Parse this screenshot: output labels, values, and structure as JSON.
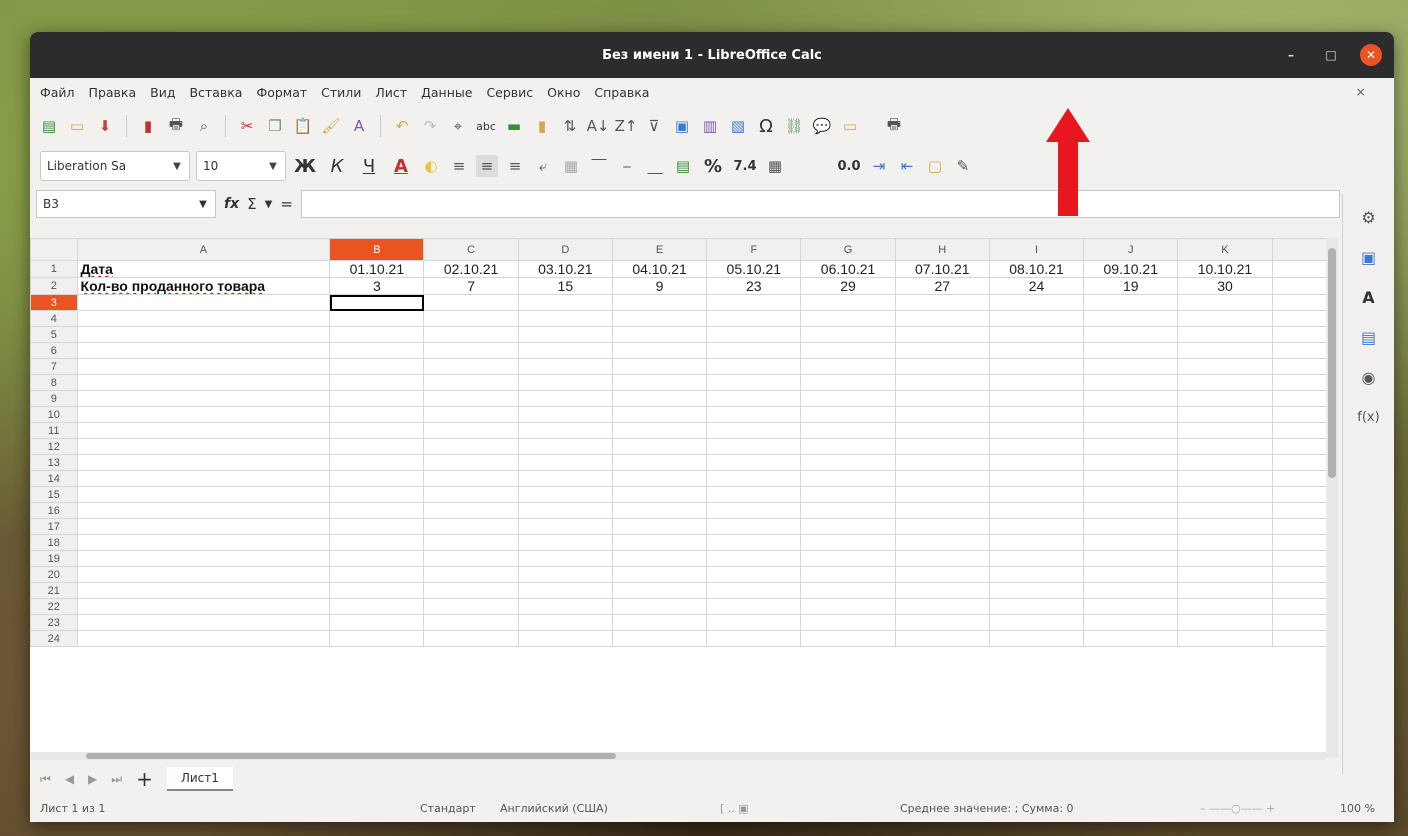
{
  "window": {
    "title": "Без имени 1 - LibreOffice Calc",
    "controls": {
      "minimize": "–",
      "maximize": "□",
      "close": "✕"
    }
  },
  "menu": {
    "items": [
      "Файл",
      "Правка",
      "Вид",
      "Вставка",
      "Формат",
      "Стили",
      "Лист",
      "Данные",
      "Сервис",
      "Окно",
      "Справка"
    ],
    "close_doc": "×"
  },
  "format": {
    "font_name": "Liberation Sa",
    "font_size": "10",
    "bold": "Ж",
    "italic": "К",
    "underline": "Ч",
    "font_color": "A",
    "percent": "%",
    "number": "7.4",
    "decimal": "0.0"
  },
  "formula_bar": {
    "cell_ref": "B3",
    "fx": "fx",
    "sum": "Σ",
    "equals": "=",
    "value": ""
  },
  "sheet": {
    "columns": [
      "A",
      "B",
      "C",
      "D",
      "E",
      "F",
      "G",
      "H",
      "I",
      "J",
      "K"
    ],
    "active_column": "B",
    "active_row": "3",
    "rows": [
      {
        "num": "1",
        "cells": [
          "Дата",
          "01.10.21",
          "02.10.21",
          "03.10.21",
          "04.10.21",
          "05.10.21",
          "06.10.21",
          "07.10.21",
          "08.10.21",
          "09.10.21",
          "10.10.21"
        ]
      },
      {
        "num": "2",
        "cells": [
          "Кол-во проданного товара",
          "3",
          "7",
          "15",
          "9",
          "23",
          "29",
          "27",
          "24",
          "19",
          "30"
        ]
      },
      {
        "num": "3",
        "cells": [
          "",
          "",
          "",
          "",
          "",
          "",
          "",
          "",
          "",
          "",
          ""
        ]
      },
      {
        "num": "4",
        "cells": []
      },
      {
        "num": "5",
        "cells": []
      },
      {
        "num": "6",
        "cells": []
      },
      {
        "num": "7",
        "cells": []
      },
      {
        "num": "8",
        "cells": []
      },
      {
        "num": "9",
        "cells": []
      },
      {
        "num": "10",
        "cells": []
      },
      {
        "num": "11",
        "cells": []
      },
      {
        "num": "12",
        "cells": []
      },
      {
        "num": "13",
        "cells": []
      },
      {
        "num": "14",
        "cells": []
      },
      {
        "num": "15",
        "cells": []
      },
      {
        "num": "16",
        "cells": []
      },
      {
        "num": "17",
        "cells": []
      },
      {
        "num": "18",
        "cells": []
      },
      {
        "num": "19",
        "cells": []
      },
      {
        "num": "20",
        "cells": []
      },
      {
        "num": "21",
        "cells": []
      },
      {
        "num": "22",
        "cells": []
      },
      {
        "num": "23",
        "cells": []
      },
      {
        "num": "24",
        "cells": []
      }
    ]
  },
  "tabs": {
    "sheet1": "Лист1",
    "add": "+"
  },
  "status": {
    "sheet_info": "Лист 1 из 1",
    "page_style": "Стандарт",
    "language": "Английский (США)",
    "selection_summary": "Среднее значение: ; Сумма: 0",
    "zoom": "100 %"
  },
  "sidebar": {
    "icons": [
      "gear-icon",
      "properties-icon",
      "styles-icon",
      "gallery-icon",
      "navigator-icon",
      "functions-icon"
    ],
    "functions_label": "f(x)"
  },
  "colors": {
    "accent": "#e95420",
    "arrow": "#e8161e"
  }
}
